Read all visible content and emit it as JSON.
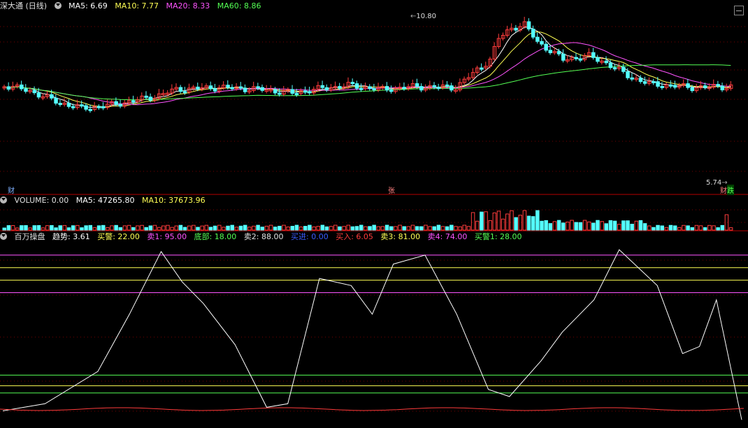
{
  "header_main": {
    "title": "深大通 (日线)",
    "ma5": "MA5: 6.69",
    "ma10": "MA10: 7.77",
    "ma20": "MA20: 8.33",
    "ma60": "MA60: 8.86"
  },
  "header_volume": {
    "title": "VOLUME: 0.00",
    "ma5": "MA5: 47265.80",
    "ma10": "MA10: 37673.96"
  },
  "header_indicator": {
    "title": "百万操盘",
    "trend": "趋势: 3.61",
    "buy_alert": "买警: 22.00",
    "sell1": "卖1: 95.00",
    "bottom": "底部: 18.00",
    "sell2": "卖2: 88.00",
    "buy_in": "买进: 0.00",
    "buy_entry": "买入: 6.05",
    "sell3": "卖3: 81.00",
    "sell4": "卖4: 74.00",
    "buy_alert1": "买警1: 28.00"
  },
  "annotations": {
    "high_label": "10.80",
    "low_label": "5.74",
    "tag_cai": "财",
    "tag_zhang": "张",
    "tag_die": "跌",
    "tag_cai2": "财"
  },
  "colors": {
    "up": "#ff3c3c",
    "down": "#54ffff",
    "ma5": "#ffffff",
    "ma10": "#ffff54",
    "ma20": "#ff54ff",
    "ma60": "#54ff54",
    "divider": "#b40000"
  },
  "chart_data": [
    {
      "type": "candlestick",
      "price_range": [
        5.74,
        10.8
      ],
      "ma_series": [
        "MA5",
        "MA10",
        "MA20",
        "MA60"
      ]
    },
    {
      "type": "bar",
      "series": [
        {
          "name": "VOLUME"
        },
        {
          "name": "MA5"
        },
        {
          "name": "MA10"
        }
      ]
    },
    {
      "type": "line",
      "ylim": [
        0,
        100
      ],
      "levels": {
        "卖1": 95,
        "卖2": 88,
        "卖3": 81,
        "卖4": 74,
        "买警1": 28,
        "买警": 22,
        "底部": 18
      },
      "series": [
        {
          "name": "趋势"
        }
      ]
    }
  ]
}
